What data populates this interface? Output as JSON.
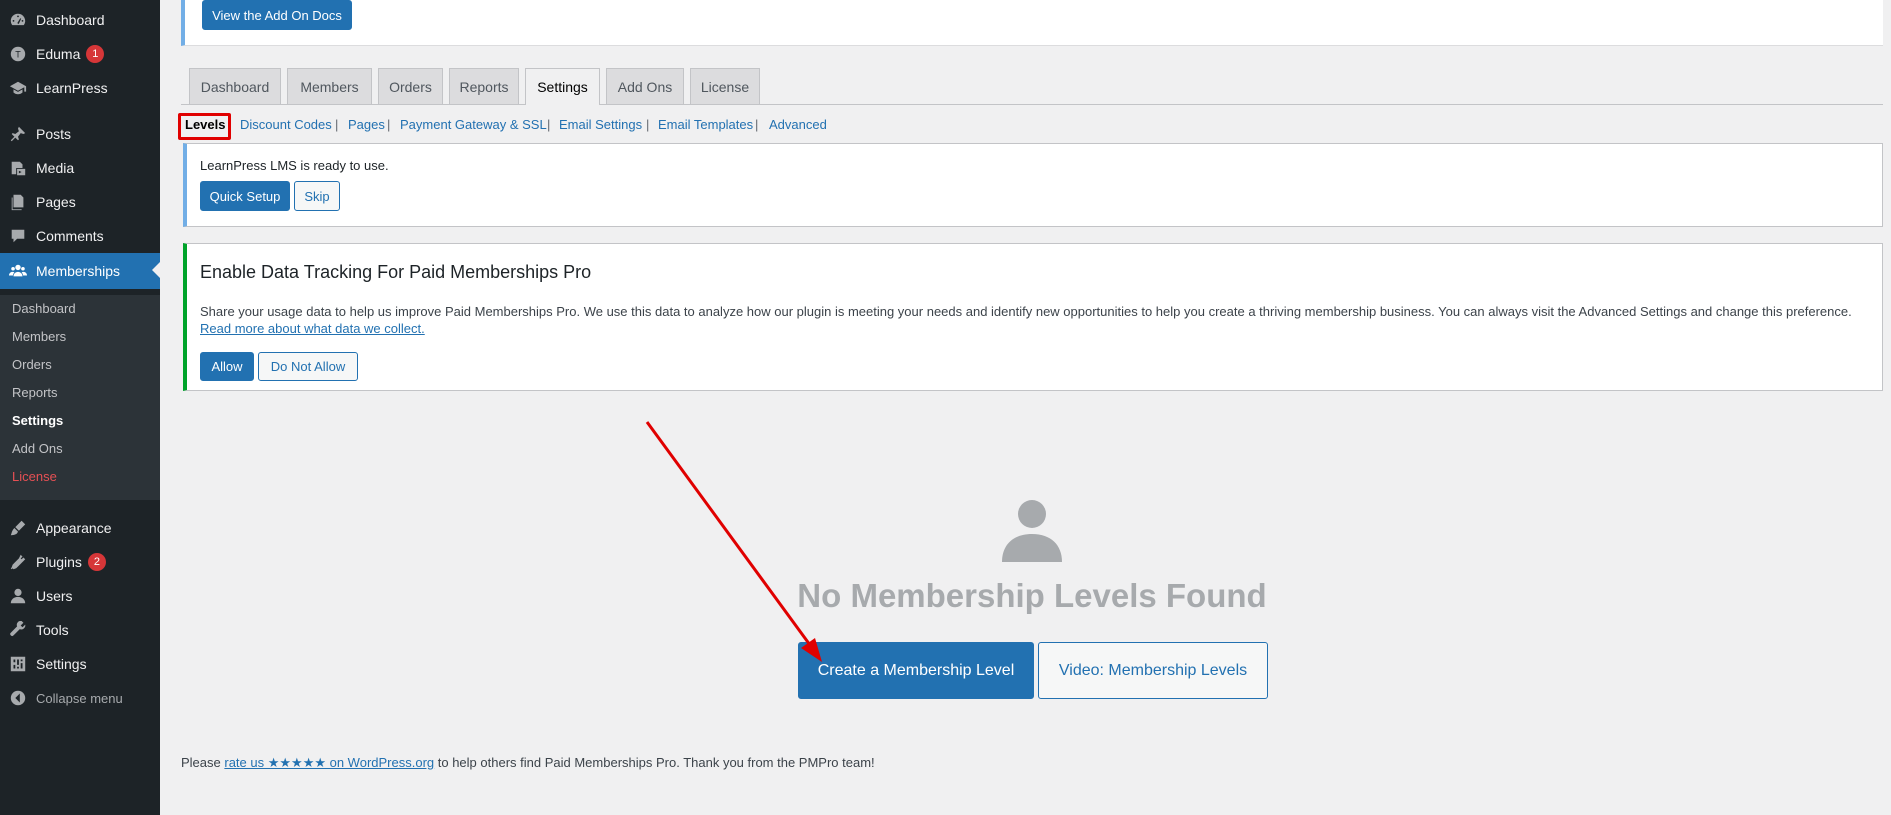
{
  "sidebar": {
    "items": [
      {
        "label": "Dashboard",
        "icon": "dashboard-icon"
      },
      {
        "label": "Eduma",
        "badge": "1",
        "icon": "eduma-icon"
      },
      {
        "label": "LearnPress",
        "icon": "learnpress-icon"
      },
      {
        "label": "Posts",
        "icon": "pin-icon"
      },
      {
        "label": "Media",
        "icon": "media-icon"
      },
      {
        "label": "Pages",
        "icon": "pages-icon"
      },
      {
        "label": "Comments",
        "icon": "comment-icon"
      },
      {
        "label": "Memberships",
        "icon": "groups-icon"
      },
      {
        "label": "Appearance",
        "icon": "brush-icon"
      },
      {
        "label": "Plugins",
        "badge": "2",
        "icon": "plugin-icon"
      },
      {
        "label": "Users",
        "icon": "user-icon"
      },
      {
        "label": "Tools",
        "icon": "wrench-icon"
      },
      {
        "label": "Settings",
        "icon": "settings-icon"
      },
      {
        "label": "Collapse menu",
        "icon": "collapse-icon"
      }
    ],
    "submenu": [
      "Dashboard",
      "Members",
      "Orders",
      "Reports",
      "Settings",
      "Add Ons",
      "License"
    ]
  },
  "top_box": {
    "button": "View the Add On Docs"
  },
  "tabs": [
    "Dashboard",
    "Members",
    "Orders",
    "Reports",
    "Settings",
    "Add Ons",
    "License"
  ],
  "active_tab": "Settings",
  "subnav": [
    "Levels",
    "Discount Codes",
    "Pages",
    "Payment Gateway & SSL",
    "Email Settings",
    "Email Templates",
    "Advanced"
  ],
  "notice_lp": {
    "text": "LearnPress LMS is ready to use.",
    "primary": "Quick Setup",
    "secondary": "Skip"
  },
  "notice_track": {
    "title": "Enable Data Tracking For Paid Memberships Pro",
    "body": "Share your usage data to help us improve Paid Memberships Pro. We use this data to analyze how our plugin is meeting your needs and identify new opportunities to help you create a thriving membership business. You can always visit the Advanced Settings and change this preference.",
    "link": "Read more about what data we collect.",
    "allow": "Allow",
    "deny": "Do Not Allow"
  },
  "empty_state": {
    "title": "No Membership Levels Found",
    "create": "Create a Membership Level",
    "video": "Video: Membership Levels"
  },
  "footer": {
    "before": "Please ",
    "link": "rate us ★★★★★ on WordPress.org",
    "after": " to help others find Paid Memberships Pro. Thank you from the PMPro team!"
  },
  "colors": {
    "accent": "#2271b1",
    "sidebar": "#1d2327",
    "highlight": "#e00000"
  }
}
